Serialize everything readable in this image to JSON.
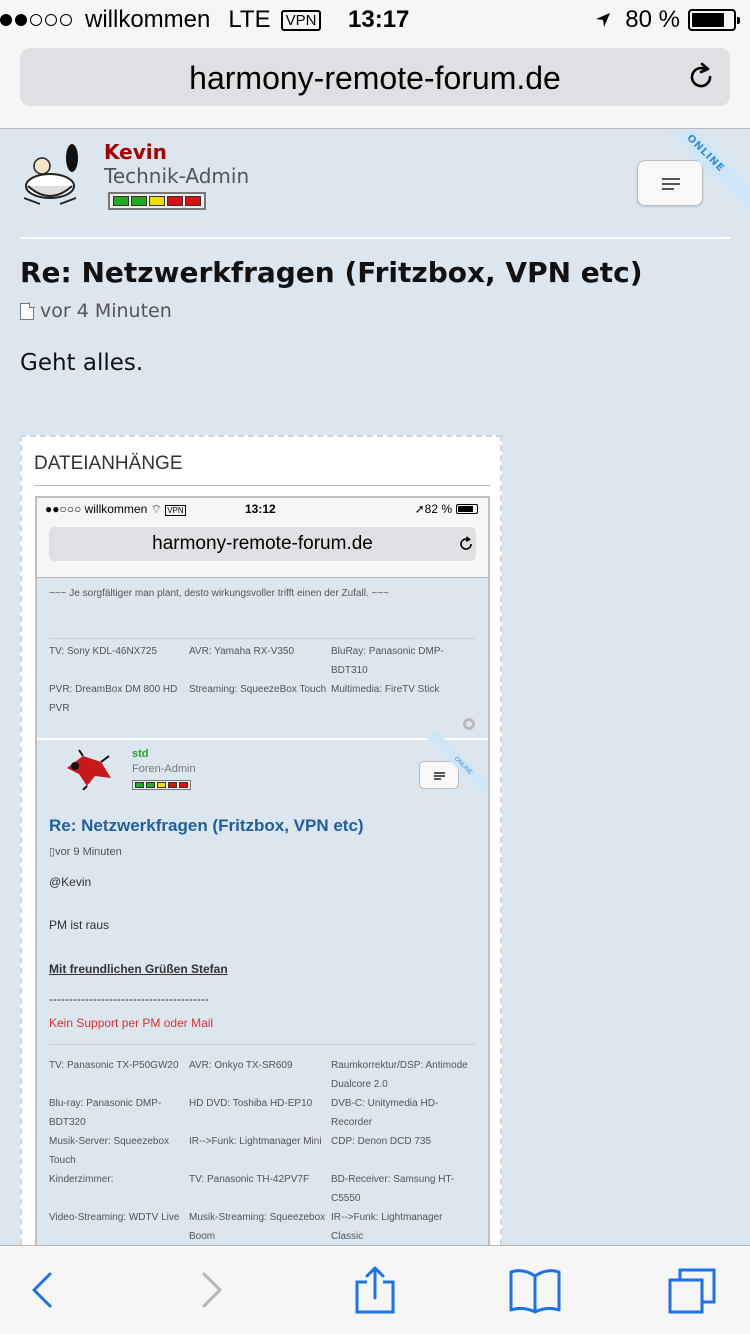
{
  "status_bar": {
    "carrier": "willkommen",
    "network": "LTE",
    "vpn": "VPN",
    "time": "13:17",
    "battery": "80 %",
    "battery_level": 0.8
  },
  "browser": {
    "url": "harmony-remote-forum.de"
  },
  "post": {
    "author": "Kevin",
    "role": "Technik-Admin",
    "status_ribbon": "ONLINE",
    "rank_colors": [
      "#22aa22",
      "#22aa22",
      "#eedd00",
      "#dd1111",
      "#dd1111"
    ],
    "title": "Re: Netzwerkfragen (Fritzbox, VPN etc)",
    "meta": "vor 4 Minuten",
    "body": "Geht alles."
  },
  "attachments": {
    "heading": "DATEIANHÄNGE",
    "screenshot": {
      "status": {
        "carrier": "willkommen",
        "vpn": "VPN",
        "time": "13:12",
        "battery": "82 %",
        "battery_level": 0.82
      },
      "url": "harmony-remote-forum.de",
      "quote": "~~~ Je sorgfältiger man plant, desto wirkungsvoller trifft einen der Zufall. ~~~",
      "sig_top": [
        [
          "TV: Sony KDL-46NX725",
          "AVR: Yamaha RX-V350",
          "BluRay: Panasonic DMP-BDT310"
        ],
        [
          "PVR: DreamBox DM 800 HD PVR",
          "Streaming: SqueezeBox Touch",
          "Multimedia: FireTV Stick"
        ]
      ],
      "user": "std",
      "role": "Foren-Admin",
      "ribbon": "ONLINE",
      "title": "Re: Netzwerkfragen (Fritzbox, VPN etc)",
      "meta": "vor 9 Minuten",
      "body_line1": "@Kevin",
      "body_line2": "PM ist raus",
      "signature": "Mit freundlichen Grüßen Stefan",
      "dashes": "----------------------------------------",
      "red_note": "Kein Support per PM oder Mail",
      "sig_bottom": [
        [
          "TV: Panasonic TX-P50GW20",
          "AVR: Onkyo TX-SR609",
          "Raumkorrektur/DSP: Antimode Dualcore 2.0"
        ],
        [
          "Blu-ray: Panasonic DMP-BDT320",
          "HD DVD: Toshiba HD-EP10",
          "DVB-C: Unitymedia HD-Recorder"
        ],
        [
          "Musik-Server: Squeezebox Touch",
          "IR-->Funk: Lightmanager Mini",
          "CDP: Denon DCD 735"
        ],
        [
          "Kinderzimmer:",
          "TV: Panasonic TH-42PV7F",
          "BD-Receiver: Samsung HT-C5550"
        ],
        [
          "Video-Streaming: WDTV Live",
          "Musik-Streaming: Squeezebox Boom",
          "IR-->Funk: Lightmanager Classic"
        ]
      ]
    }
  }
}
